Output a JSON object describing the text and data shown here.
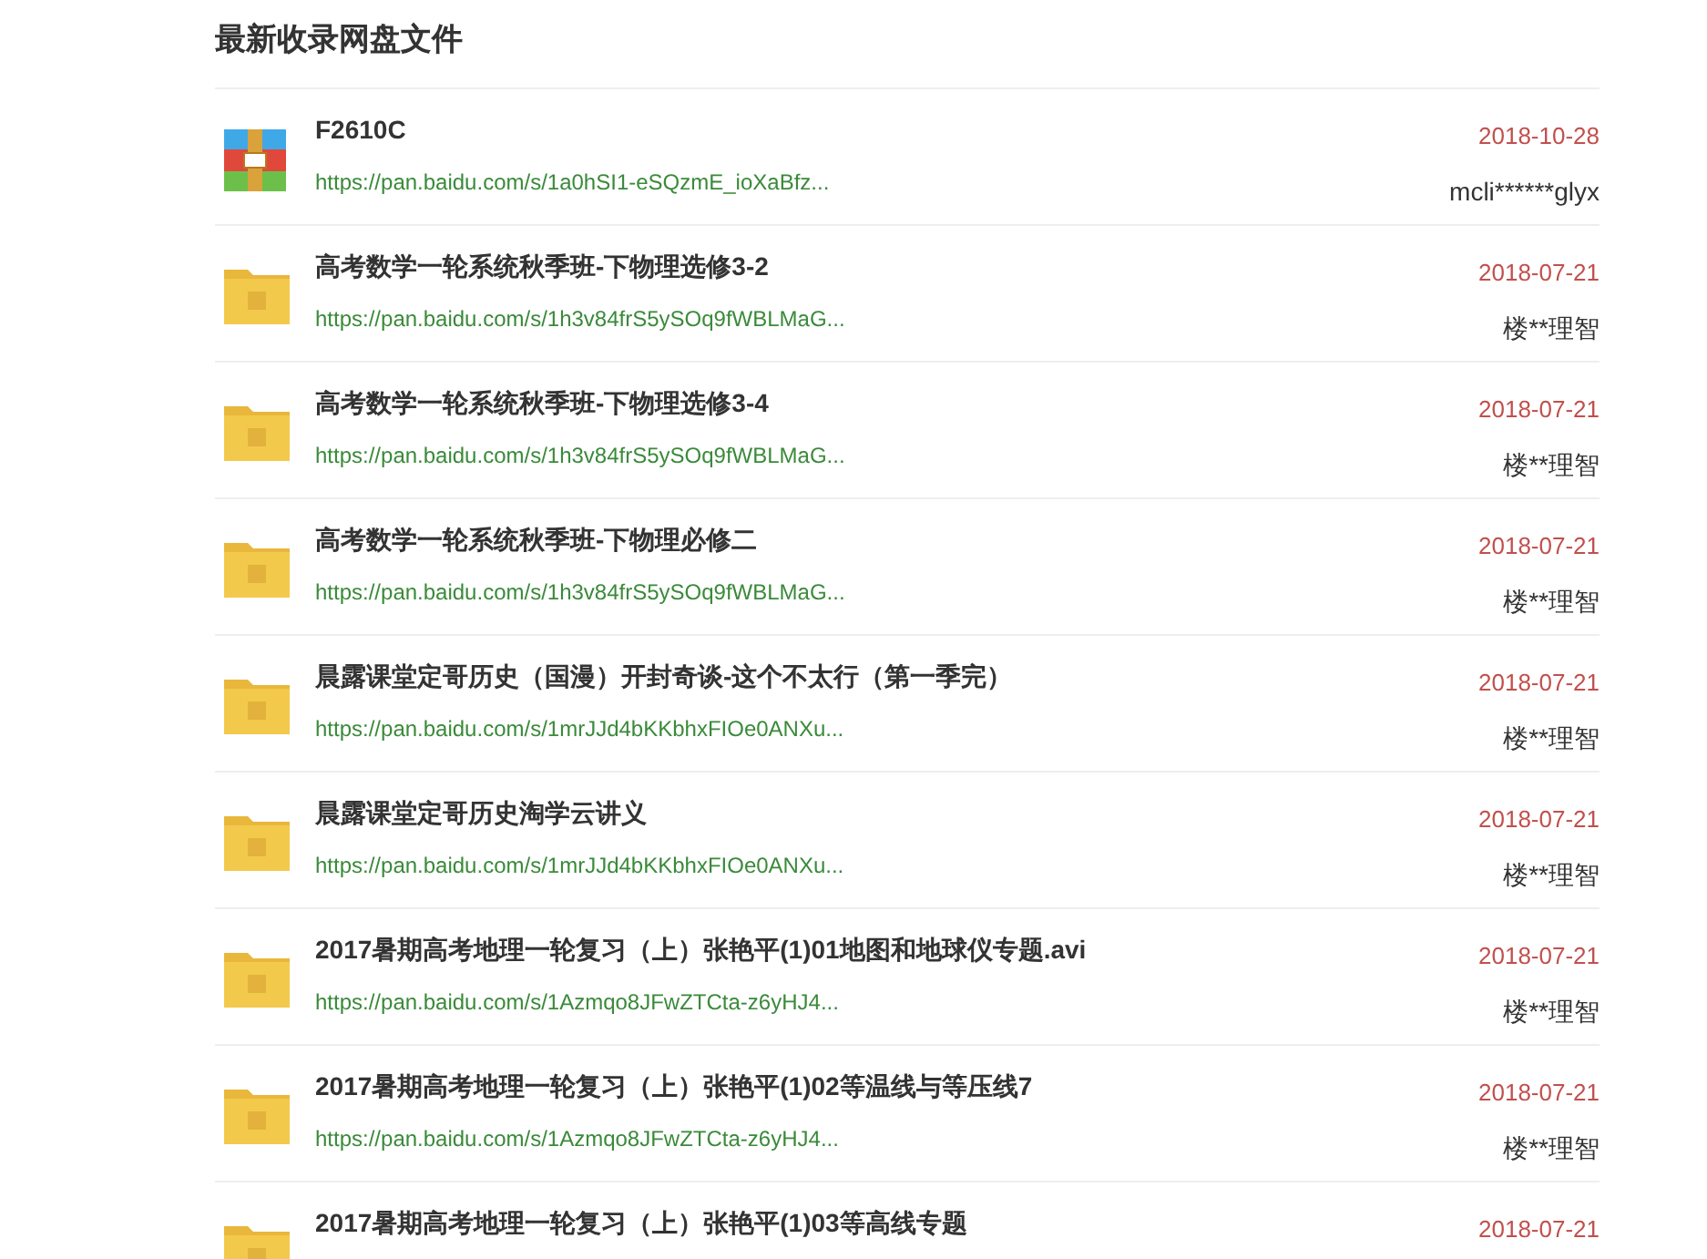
{
  "heading": "最新收录网盘文件",
  "files": [
    {
      "kind": "archive",
      "name": "F2610C",
      "url": "https://pan.baidu.com/s/1a0hSI1-eSQzmE_ioXaBfz...",
      "date": "2018-10-28",
      "user": "mcli******glyx"
    },
    {
      "kind": "folder",
      "name": "高考数学一轮系统秋季班-下物理选修3-2",
      "url": "https://pan.baidu.com/s/1h3v84frS5ySOq9fWBLMaG...",
      "date": "2018-07-21",
      "user": "楼**理智"
    },
    {
      "kind": "folder",
      "name": "高考数学一轮系统秋季班-下物理选修3-4",
      "url": "https://pan.baidu.com/s/1h3v84frS5ySOq9fWBLMaG...",
      "date": "2018-07-21",
      "user": "楼**理智"
    },
    {
      "kind": "folder",
      "name": "高考数学一轮系统秋季班-下物理必修二",
      "url": "https://pan.baidu.com/s/1h3v84frS5ySOq9fWBLMaG...",
      "date": "2018-07-21",
      "user": "楼**理智"
    },
    {
      "kind": "folder",
      "name": "晨露课堂定哥历史（国漫）开封奇谈-这个不太行（第一季完）",
      "url": "https://pan.baidu.com/s/1mrJJd4bKKbhxFIOe0ANXu...",
      "date": "2018-07-21",
      "user": "楼**理智"
    },
    {
      "kind": "folder",
      "name": "晨露课堂定哥历史淘学云讲义",
      "url": "https://pan.baidu.com/s/1mrJJd4bKKbhxFIOe0ANXu...",
      "date": "2018-07-21",
      "user": "楼**理智"
    },
    {
      "kind": "folder",
      "name": "2017暑期高考地理一轮复习（上）张艳平(1)01地图和地球仪专题.avi",
      "url": "https://pan.baidu.com/s/1Azmqo8JFwZTCta-z6yHJ4...",
      "date": "2018-07-21",
      "user": "楼**理智"
    },
    {
      "kind": "folder",
      "name": "2017暑期高考地理一轮复习（上）张艳平(1)02等温线与等压线7",
      "url": "https://pan.baidu.com/s/1Azmqo8JFwZTCta-z6yHJ4...",
      "date": "2018-07-21",
      "user": "楼**理智"
    },
    {
      "kind": "folder",
      "name": "2017暑期高考地理一轮复习（上）张艳平(1)03等高线专题",
      "date": "2018-07-21"
    }
  ]
}
